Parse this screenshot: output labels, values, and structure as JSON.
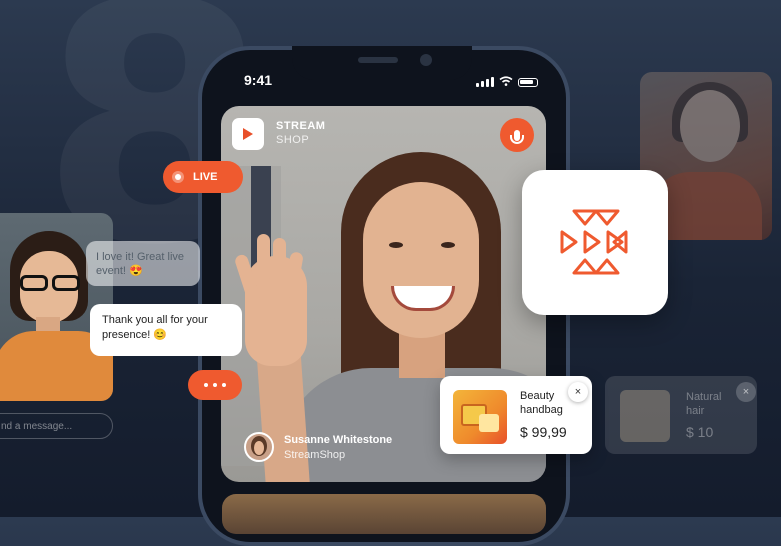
{
  "background": {
    "glyph": "8"
  },
  "colors": {
    "accent": "#ef5a2f",
    "background": "#1a2436"
  },
  "phone": {
    "status_time": "9:41"
  },
  "stream": {
    "brand_line1": "STREAM",
    "brand_line2": "SHOP",
    "host_name": "Susanne Whitestone",
    "host_channel": "StreamShop"
  },
  "live_badge": {
    "label": "LIVE"
  },
  "chat": {
    "message1": "I love it! Great live event! 😍",
    "message2": "Thank you all for your presence! 😊",
    "input_placeholder": "nd a message..."
  },
  "product": {
    "name_line1": "Beauty",
    "name_line2": "handbag",
    "price": "$ 99,99",
    "close_label": "×"
  },
  "product_faded": {
    "name_line1": "Natural",
    "name_line2": "hair",
    "price": "$ 10",
    "close_label": "×"
  },
  "icons": [
    "play-icon",
    "microphone-icon",
    "live-dot-icon",
    "typing-dots-icon",
    "app-logo-icon",
    "close-icon",
    "signal-icon",
    "wifi-icon",
    "battery-icon"
  ]
}
